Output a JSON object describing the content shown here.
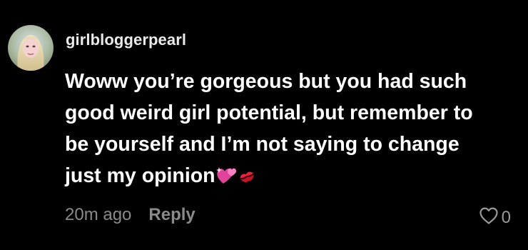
{
  "comment": {
    "username": "girlbloggerpearl",
    "avatar_icon": "profile-photo",
    "body_lines": [
      "Woww you’re gorgeous but you had such",
      "good weird girl potential, but remember to",
      "be yourself and I’m not saying to change",
      "just my opinion"
    ],
    "emojis": [
      "two-hearts-emoji",
      "kiss-mark-emoji"
    ],
    "timestamp": "20m ago",
    "reply_label": "Reply",
    "like_icon": "heart-outline-icon",
    "like_count": "0"
  },
  "colors": {
    "background": "#000000",
    "primary_text": "#ffffff",
    "secondary_text": "#8a8a8a"
  }
}
